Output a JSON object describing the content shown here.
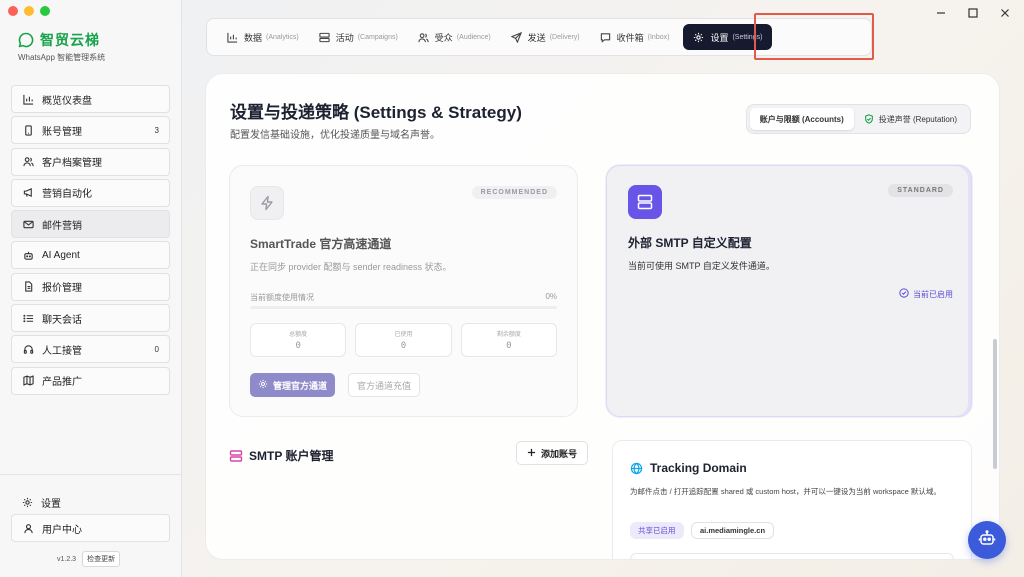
{
  "app": {
    "name": "智贸云梯",
    "subtitle": "WhatsApp 智能管理系统",
    "version": "v1.2.3",
    "check_update": "检查更新",
    "accent": "#16a34a"
  },
  "sidebar": {
    "items": [
      {
        "label": "概览仪表盘",
        "icon": "bar-chart-icon",
        "badge": ""
      },
      {
        "label": "账号管理",
        "icon": "phone-icon",
        "badge": "3"
      },
      {
        "label": "客户档案管理",
        "icon": "users-icon",
        "badge": ""
      },
      {
        "label": "营销自动化",
        "icon": "megaphone-icon",
        "badge": ""
      },
      {
        "label": "邮件营销",
        "icon": "mail-icon",
        "badge": "",
        "active": true
      },
      {
        "label": "AI Agent",
        "icon": "bot-icon",
        "badge": ""
      },
      {
        "label": "报价管理",
        "icon": "file-icon",
        "badge": ""
      },
      {
        "label": "聊天会话",
        "icon": "list-icon",
        "badge": ""
      },
      {
        "label": "人工接管",
        "icon": "headset-icon",
        "badge": "0"
      },
      {
        "label": "产品推广",
        "icon": "map-icon",
        "badge": ""
      }
    ],
    "settings_label": "设置",
    "user_center_label": "用户中心"
  },
  "topnav": {
    "tabs": [
      {
        "label": "数据",
        "en": "(Analytics)",
        "icon": "bar-chart-icon"
      },
      {
        "label": "活动",
        "en": "(Campaigns)",
        "icon": "layout-icon"
      },
      {
        "label": "受众",
        "en": "(Audience)",
        "icon": "users-icon"
      },
      {
        "label": "发送",
        "en": "(Delivery)",
        "icon": "send-icon"
      },
      {
        "label": "收件箱",
        "en": "(Inbox)",
        "icon": "message-icon"
      },
      {
        "label": "设置",
        "en": "(Settings)",
        "icon": "gear-icon",
        "active": true
      }
    ]
  },
  "page": {
    "title": "设置与投递策略 (Settings & Strategy)",
    "subtitle": "配置发信基础设施，优化投递质量与域名声誉。",
    "segment": {
      "accounts": "账户与限额 (Accounts)",
      "reputation": "投递声誉 (Reputation)"
    }
  },
  "official_card": {
    "tag": "RECOMMENDED",
    "title": "SmartTrade 官方高速通道",
    "desc": "正在同步 provider 配额与 sender readiness 状态。",
    "quota_label": "当前额度使用情况",
    "quota_pct": "0%",
    "quota_fraction": 0,
    "stats": [
      {
        "label": "总额度",
        "value": "0"
      },
      {
        "label": "已使用",
        "value": "0"
      },
      {
        "label": "剩余额度",
        "value": "0"
      }
    ],
    "manage_btn": "管理官方通道",
    "topup_btn": "官方通道充值"
  },
  "smtp_card": {
    "tag": "STANDARD",
    "title": "外部 SMTP 自定义配置",
    "desc": "当前可使用 SMTP 自定义发件通道。",
    "enabled": "当前已启用",
    "accent": "#6954e8"
  },
  "smtp_accounts": {
    "title": "SMTP 账户管理",
    "add_btn": "添加账号"
  },
  "tracking": {
    "title": "Tracking Domain",
    "desc": "为邮件点击 / 打开追踪配置 shared 或 custom host，并可以一键设为当前 workspace 默认域。",
    "shared_chip": "共享已启用",
    "domain": "ai.mediamingle.cn"
  }
}
